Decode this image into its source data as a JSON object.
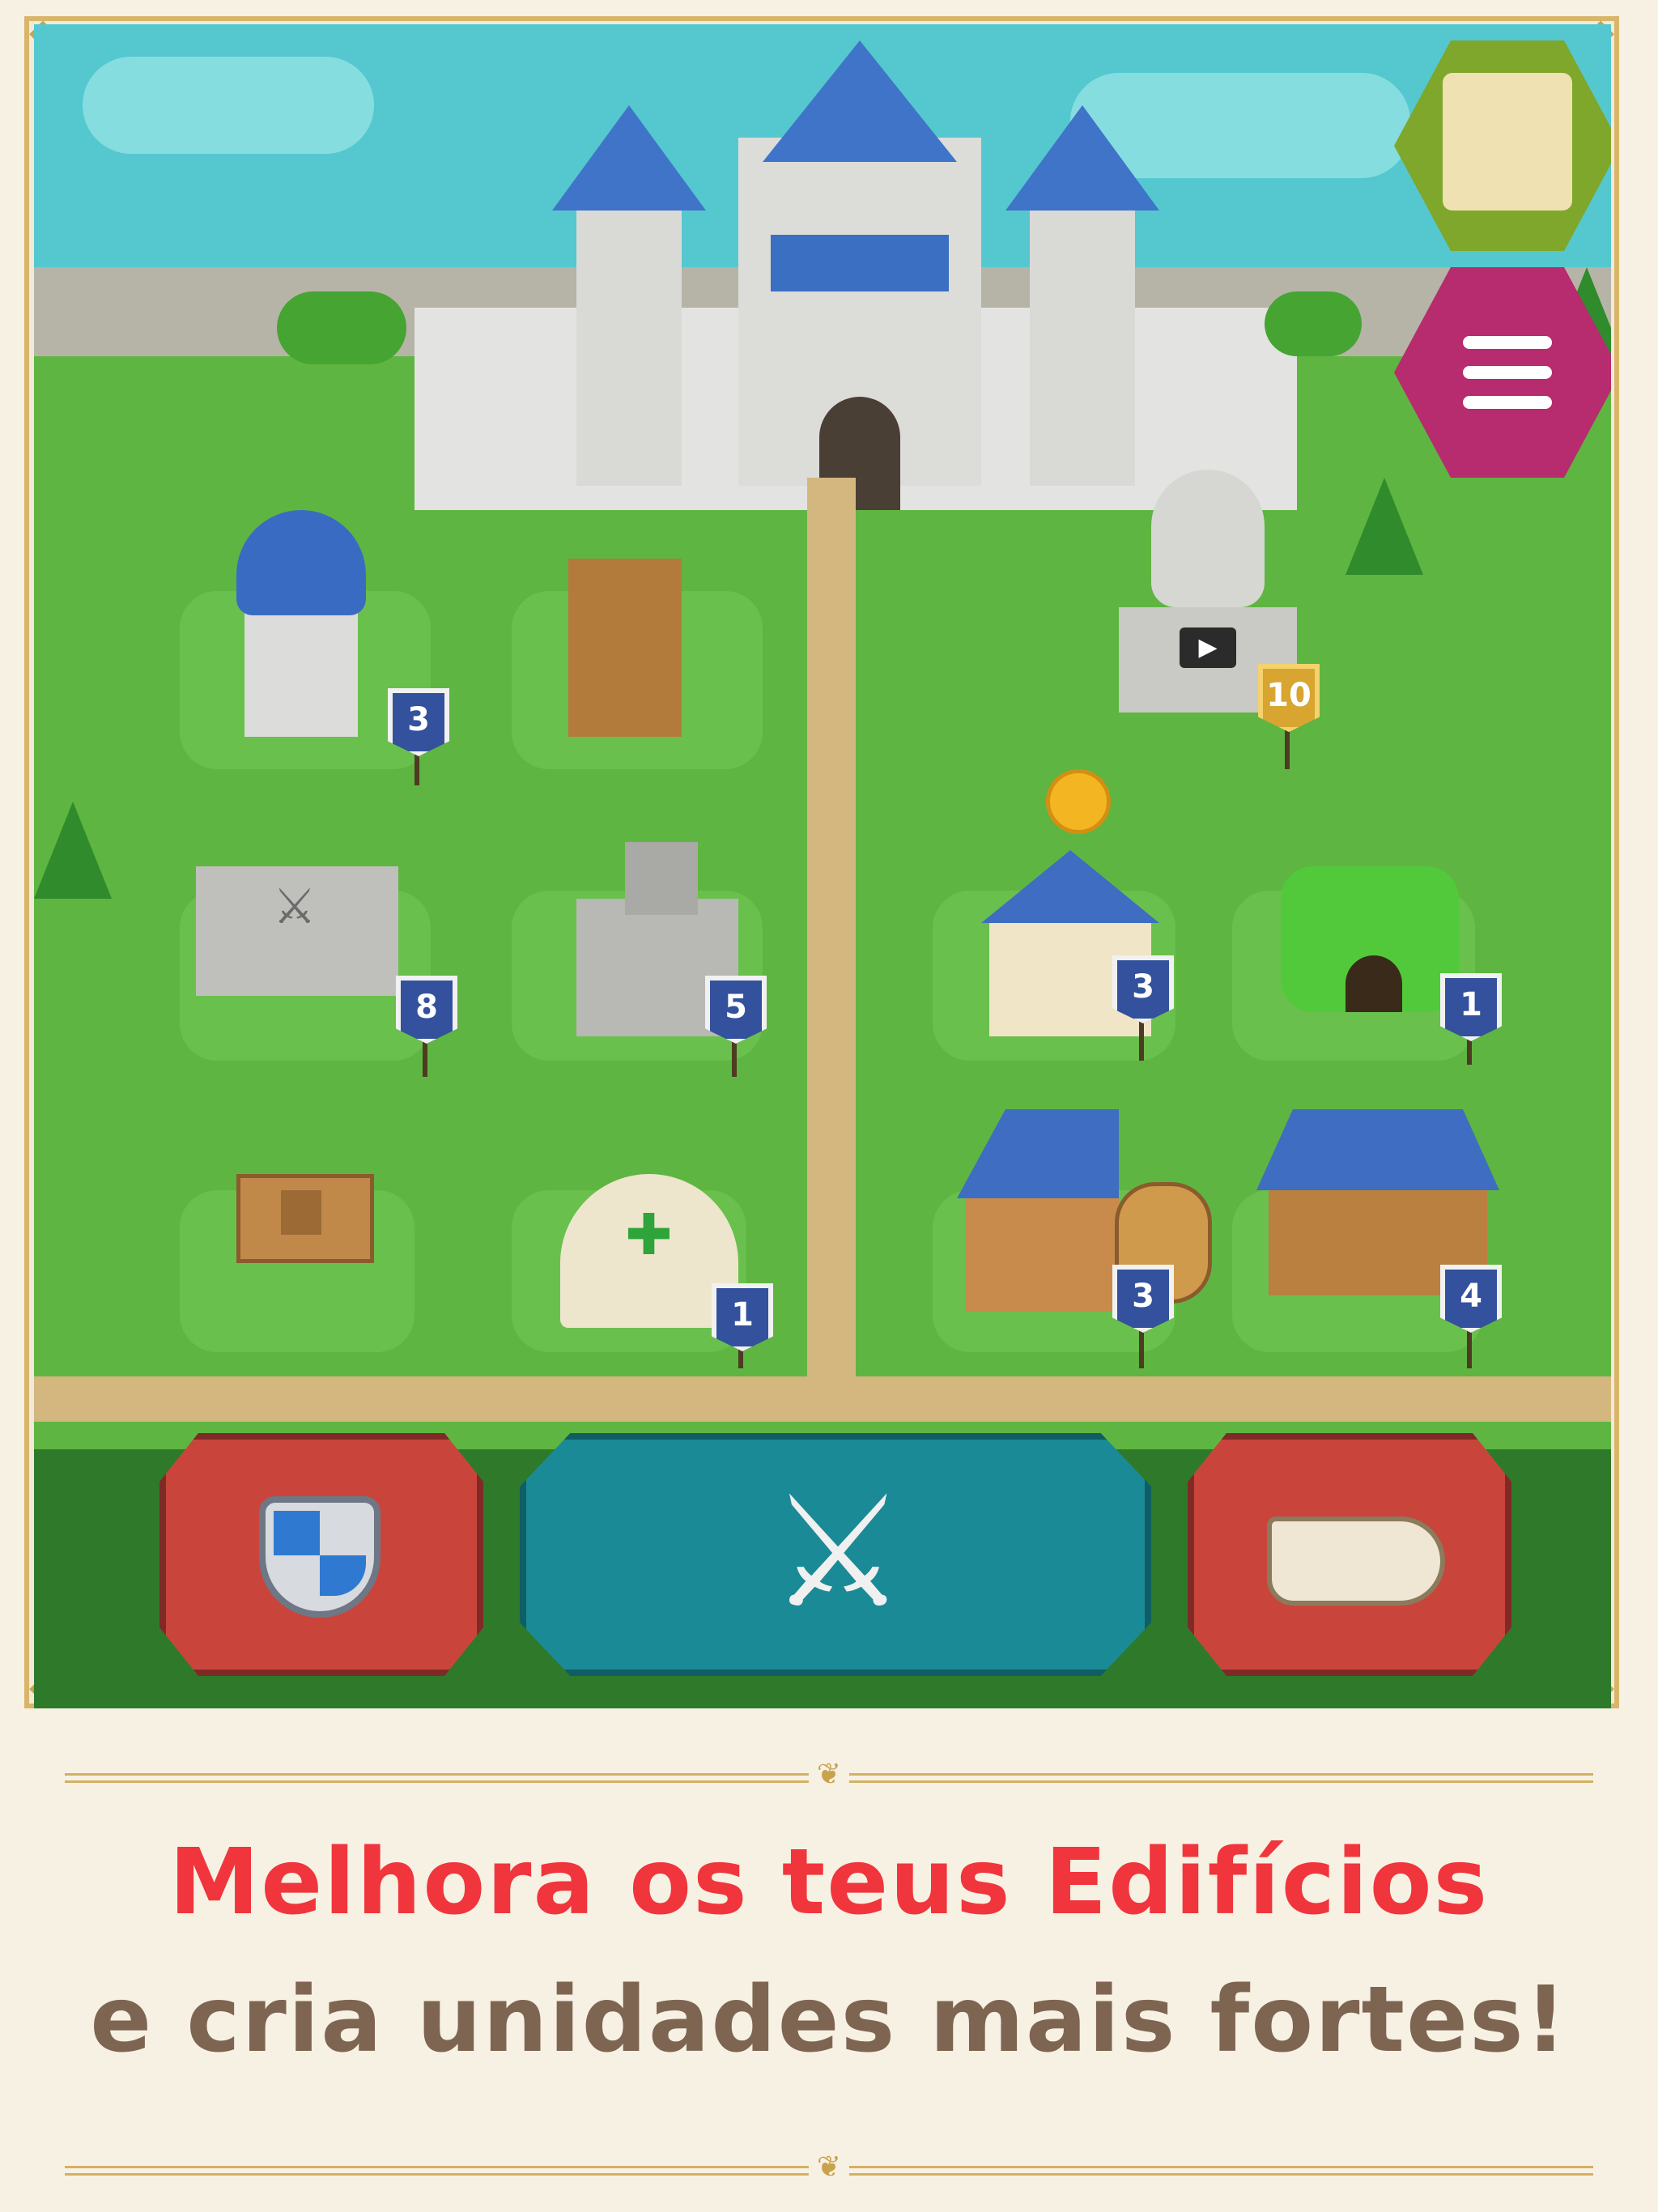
{
  "scene": {
    "buildings": [
      {
        "id": "mage-tower",
        "level": "3"
      },
      {
        "id": "workshop",
        "level": ""
      },
      {
        "id": "statue",
        "level": "10"
      },
      {
        "id": "barracks",
        "level": "8"
      },
      {
        "id": "archery",
        "level": "5"
      },
      {
        "id": "bank",
        "level": "3"
      },
      {
        "id": "crystal-mine",
        "level": "1"
      },
      {
        "id": "empty-lot",
        "level": ""
      },
      {
        "id": "infirmary",
        "level": "1"
      },
      {
        "id": "tavern",
        "level": "3"
      },
      {
        "id": "stable",
        "level": "4"
      }
    ]
  },
  "icons": {
    "quest": "scroll-icon",
    "menu": "menu-list-icon",
    "defense": "shield-icon",
    "battle": "crossed-swords-icon",
    "horn": "horn-icon"
  },
  "colors": {
    "headline_red": "#f0353d",
    "headline_brown": "#7e6552",
    "banner_blue": "#33519c",
    "button_red": "#c9453c",
    "button_teal": "#1a8a96",
    "menu_magenta": "#b72b6f"
  },
  "caption": {
    "line1": "Melhora os teus Edifícios",
    "line2": "e cria unidades mais fortes!"
  }
}
